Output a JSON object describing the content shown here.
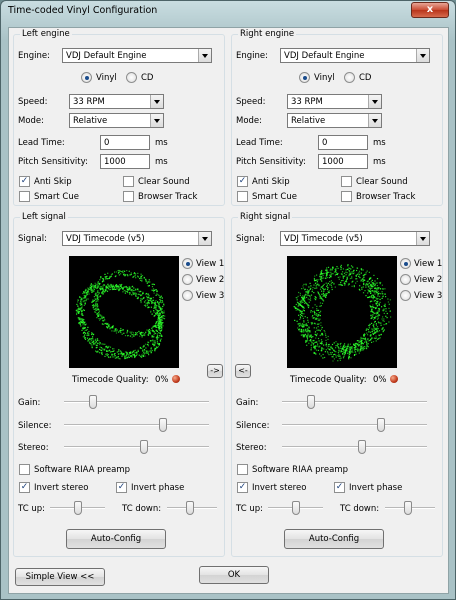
{
  "window": {
    "title": "Time-coded Vinyl Configuration",
    "close_glyph": "x"
  },
  "left_engine": {
    "title": "Left engine",
    "engine_label": "Engine:",
    "engine_value": "VDJ Default Engine",
    "vinyl_label": "Vinyl",
    "cd_label": "CD",
    "selected_media": "Vinyl",
    "speed_label": "Speed:",
    "speed_value": "33 RPM",
    "mode_label": "Mode:",
    "mode_value": "Relative",
    "lead_time_label": "Lead Time:",
    "lead_time_value": "0",
    "lead_time_unit": "ms",
    "pitch_label": "Pitch Sensitivity:",
    "pitch_value": "1000",
    "pitch_unit": "ms",
    "anti_skip_label": "Anti Skip",
    "anti_skip": true,
    "clear_sound_label": "Clear Sound",
    "clear_sound": false,
    "smart_cue_label": "Smart Cue",
    "smart_cue": false,
    "browser_track_label": "Browser Track",
    "browser_track": false
  },
  "right_engine": {
    "title": "Right engine",
    "engine_label": "Engine:",
    "engine_value": "VDJ Default Engine",
    "vinyl_label": "Vinyl",
    "cd_label": "CD",
    "selected_media": "Vinyl",
    "speed_label": "Speed:",
    "speed_value": "33 RPM",
    "mode_label": "Mode:",
    "mode_value": "Relative",
    "lead_time_label": "Lead Time:",
    "lead_time_value": "0",
    "lead_time_unit": "ms",
    "pitch_label": "Pitch Sensitivity:",
    "pitch_value": "1000",
    "pitch_unit": "ms",
    "anti_skip_label": "Anti Skip",
    "anti_skip": true,
    "clear_sound_label": "Clear Sound",
    "clear_sound": false,
    "smart_cue_label": "Smart Cue",
    "smart_cue": false,
    "browser_track_label": "Browser Track",
    "browser_track": false
  },
  "left_signal": {
    "title": "Left signal",
    "signal_label": "Signal:",
    "signal_value": "VDJ Timecode (v5)",
    "views": [
      "View 1",
      "View 2",
      "View 3"
    ],
    "selected_view": "View 1",
    "quality_label": "Timecode Quality:",
    "quality_value": "0%",
    "copy_button": "->",
    "gain_label": "Gain:",
    "gain": 0.2,
    "silence_label": "Silence:",
    "silence": 0.68,
    "stereo_label": "Stereo:",
    "stereo": 0.55,
    "riaa_label": "Software RIAA preamp",
    "riaa": false,
    "invert_stereo_label": "Invert stereo",
    "invert_stereo": true,
    "invert_phase_label": "Invert phase",
    "invert_phase": true,
    "tc_up_label": "TC up:",
    "tc_up": 0.5,
    "tc_down_label": "TC down:",
    "tc_down": 0.45,
    "autoconfig_label": "Auto-Config"
  },
  "right_signal": {
    "title": "Right signal",
    "signal_label": "Signal:",
    "signal_value": "VDJ Timecode (v5)",
    "views": [
      "View 1",
      "View 2",
      "View 3"
    ],
    "selected_view": "View 1",
    "quality_label": "Timecode Quality:",
    "quality_value": "0%",
    "copy_button": "<-",
    "gain_label": "Gain:",
    "gain": 0.2,
    "silence_label": "Silence:",
    "silence": 0.68,
    "stereo_label": "Stereo:",
    "stereo": 0.55,
    "riaa_label": "Software RIAA preamp",
    "riaa": false,
    "invert_stereo_label": "Invert stereo",
    "invert_stereo": true,
    "invert_phase_label": "Invert phase",
    "invert_phase": true,
    "tc_up_label": "TC up:",
    "tc_up": 0.5,
    "tc_down_label": "TC down:",
    "tc_down": 0.45,
    "autoconfig_label": "Auto-Config"
  },
  "footer": {
    "simple_view_label": "Simple View <<",
    "ok_label": "OK"
  },
  "colors": {
    "scope_trace": "#2bff2b",
    "scope_bg": "#000000",
    "led": "#c0391b",
    "titlebar": "#b9d0d4"
  }
}
